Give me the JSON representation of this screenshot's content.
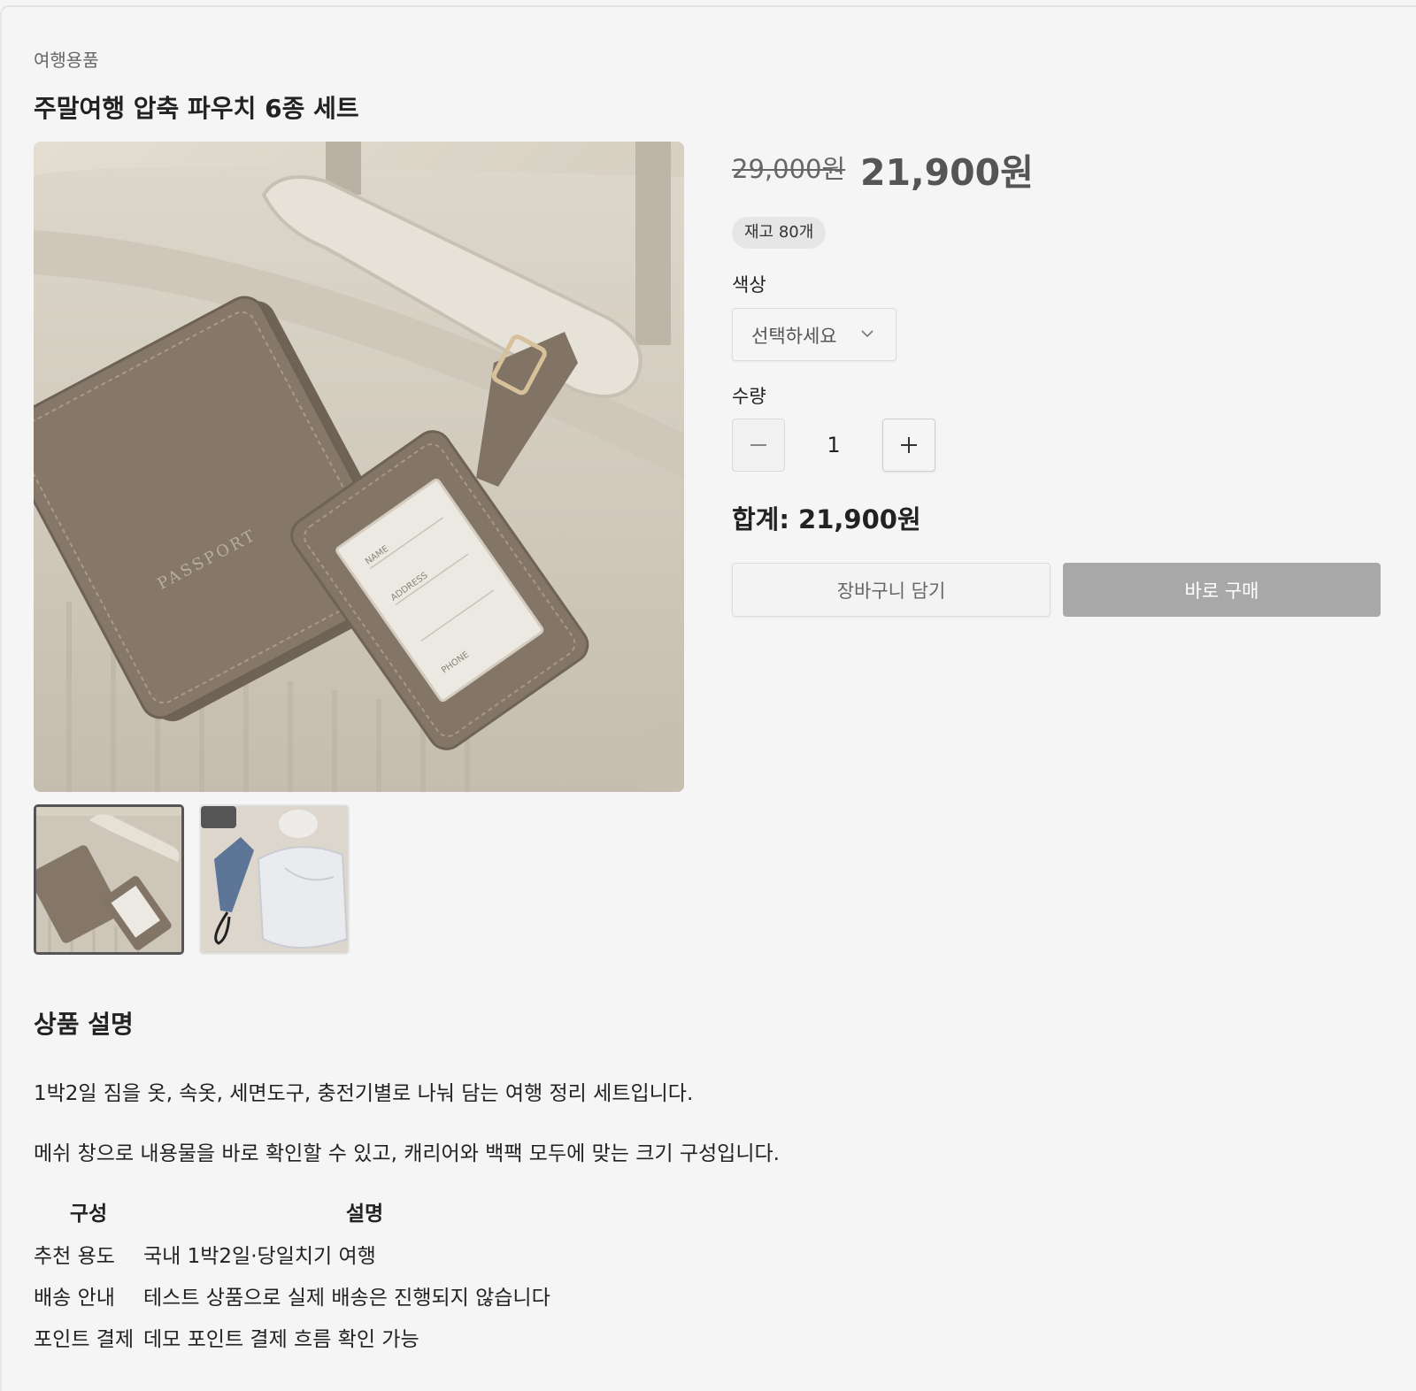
{
  "breadcrumb": {
    "category": "여행용품"
  },
  "product": {
    "title": "주말여행 압축 파우치 6종 세트",
    "original_price": "29,000원",
    "sale_price": "21,900원",
    "stock_badge": "재고 80개"
  },
  "gallery": {
    "main_image_alt": "PASSPORT",
    "tag_labels": [
      "NAME",
      "ADDRESS",
      "PHONE"
    ],
    "thumbnails": [
      {
        "active": true
      },
      {
        "active": false
      }
    ]
  },
  "options": {
    "color_label": "색상",
    "color_select_value": "선택하세요",
    "quantity_label": "수량",
    "quantity_value": "1"
  },
  "summary": {
    "total_text": "합계: 21,900원"
  },
  "actions": {
    "cart_label": "장바구니 담기",
    "buy_label": "바로 구매"
  },
  "description": {
    "heading": "상품 설명",
    "paragraphs": [
      "1박2일 짐을 옷, 속옷, 세면도구, 충전기별로 나눠 담는 여행 정리 세트입니다.",
      "메쉬 창으로 내용물을 바로 확인할 수 있고, 캐리어와 백팩 모두에 맞는 크기 구성입니다."
    ],
    "table": {
      "headers": [
        "구성",
        "설명"
      ],
      "rows": [
        [
          "추천 용도",
          "국내 1박2일·당일치기 여행"
        ],
        [
          "배송 안내",
          "테스트 상품으로 실제 배송은 진행되지 않습니다"
        ],
        [
          "포인트 결제",
          "데모 포인트 결제 흐름 확인 가능"
        ]
      ]
    }
  },
  "colors": {
    "background": "#f5f5f5",
    "buy_button": "#a8a8a8",
    "leather": "#7f7264",
    "suitcase": "#d6d0c3"
  }
}
